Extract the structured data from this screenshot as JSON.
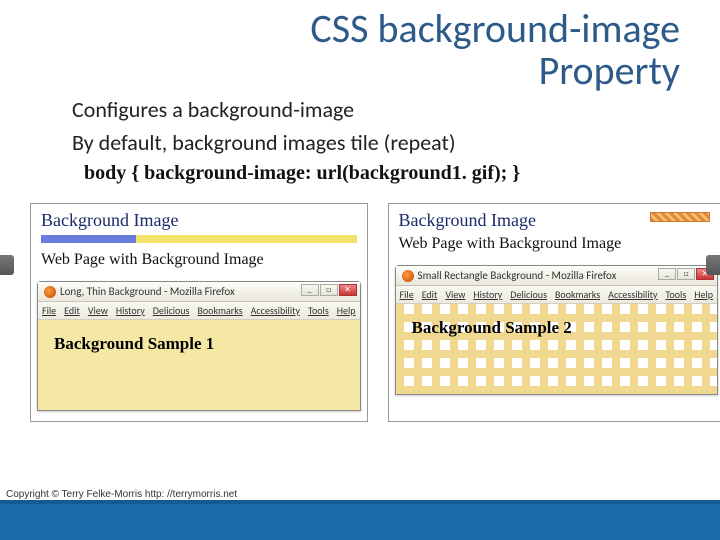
{
  "title_line1": "CSS background-image",
  "title_line2": "Property",
  "bullets": {
    "b1": "Configures a background-image",
    "b2": "By default, background images tile (repeat)"
  },
  "code": "body { background-image: url(background1. gif); }",
  "examples": {
    "left": {
      "heading": "Background Image",
      "subheading": "Web Page with Background Image",
      "browser_title": "Long, Thin Background - Mozilla Firefox",
      "sample": "Background Sample 1"
    },
    "right": {
      "heading": "Background Image",
      "subheading": "Web Page with Background Image",
      "browser_title": "Small Rectangle Background - Mozilla Firefox",
      "sample": "Background Sample 2"
    }
  },
  "menu": {
    "file": "File",
    "edit": "Edit",
    "view": "View",
    "history": "History",
    "delicious": "Delicious",
    "bookmarks": "Bookmarks",
    "accessibility": "Accessibility",
    "tools": "Tools",
    "help": "Help"
  },
  "win": {
    "min": "_",
    "max": "□",
    "close": "✕"
  },
  "copyright": "Copyright © Terry Felke-Morris http: //terrymorris.net"
}
